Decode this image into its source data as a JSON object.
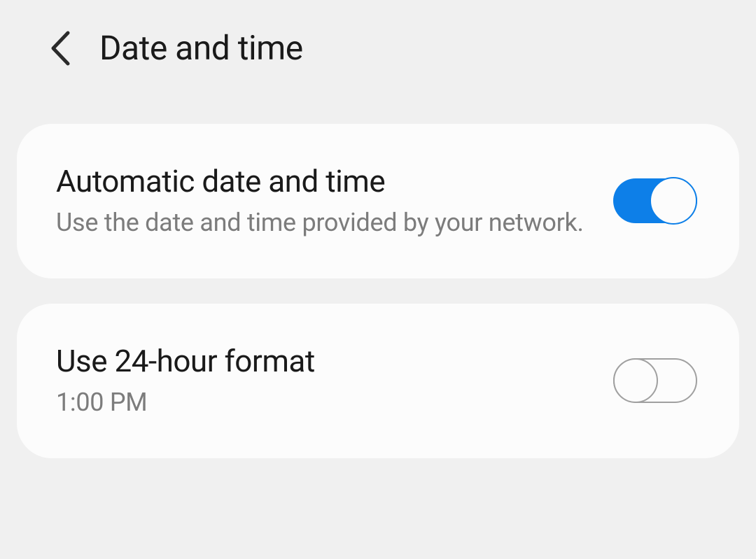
{
  "header": {
    "title": "Date and time"
  },
  "settings": [
    {
      "title": "Automatic date and time",
      "subtitle": "Use the date and time provided by your network.",
      "enabled": true
    },
    {
      "title": "Use 24-hour format",
      "subtitle": "1:00 PM",
      "enabled": false
    }
  ]
}
